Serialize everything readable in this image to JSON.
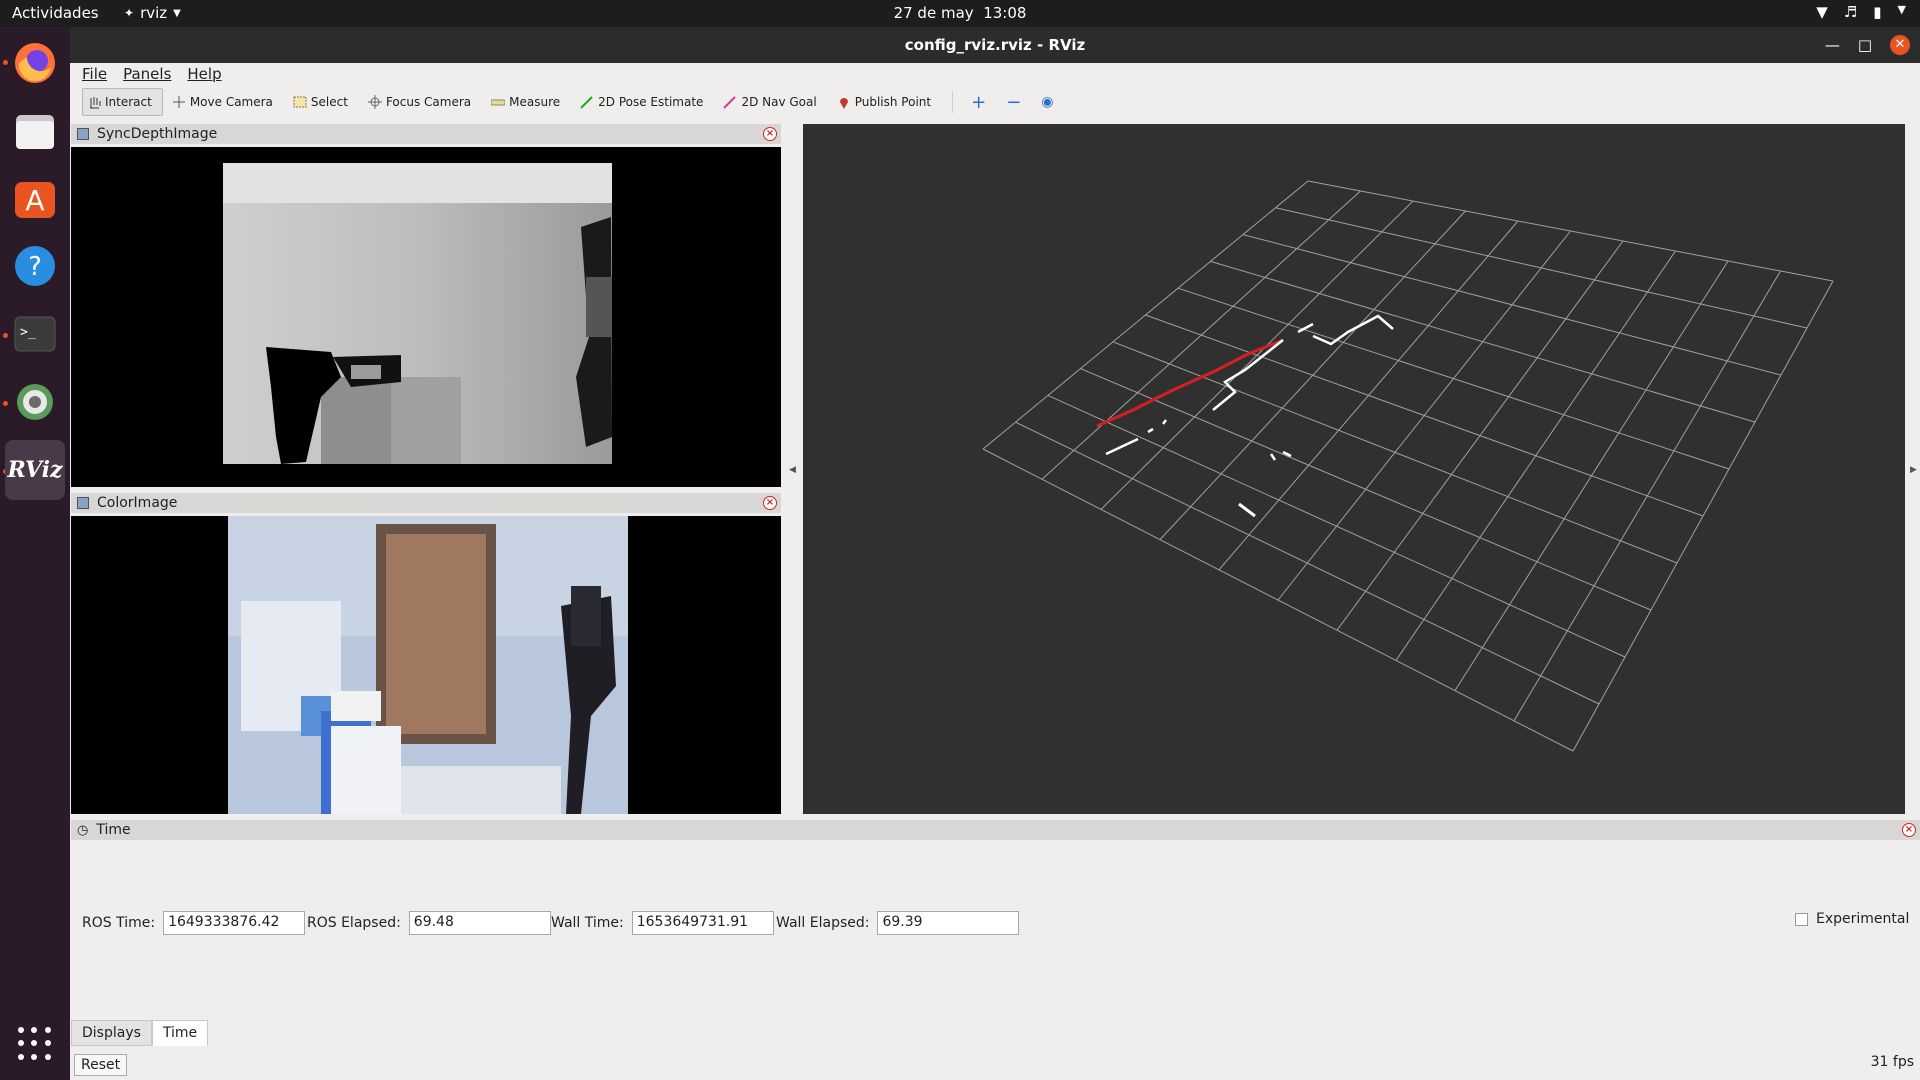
{
  "topbar": {
    "activities": "Actividades",
    "app_name": "rviz",
    "clock_date": "27 de may",
    "clock_time": "13:08"
  },
  "dock": {
    "items": [
      "firefox-icon",
      "files-icon",
      "app-store-icon",
      "help-icon",
      "terminal-icon",
      "settings-icon",
      "rviz-icon"
    ],
    "rviz_label": "RViz"
  },
  "window": {
    "title": "config_rviz.rviz - RViz"
  },
  "menu": {
    "file": "File",
    "panels": "Panels",
    "help": "Help"
  },
  "toolbar": {
    "interact": "Interact",
    "move_camera": "Move Camera",
    "select": "Select",
    "focus_camera": "Focus Camera",
    "measure": "Measure",
    "pose_estimate": "2D Pose Estimate",
    "nav_goal": "2D Nav Goal",
    "publish_point": "Publish Point"
  },
  "panels": {
    "depth_title": "SyncDepthImage",
    "color_title": "ColorImage",
    "time_title": "Time"
  },
  "time": {
    "ros_time_label": "ROS Time:",
    "ros_time_value": "1649333876.42",
    "ros_elapsed_label": "ROS Elapsed:",
    "ros_elapsed_value": "69.48",
    "wall_time_label": "Wall Time:",
    "wall_time_value": "1653649731.91",
    "wall_elapsed_label": "Wall Elapsed:",
    "wall_elapsed_value": "69.39",
    "experimental_label": "Experimental"
  },
  "bottom": {
    "tab_displays": "Displays",
    "tab_time": "Time",
    "reset": "Reset",
    "fps": "31 fps"
  },
  "colors": {
    "accent": "#e95420",
    "viewport_bg": "#303030",
    "grid_line": "#a0a0a0",
    "laser_red": "#d42020"
  }
}
